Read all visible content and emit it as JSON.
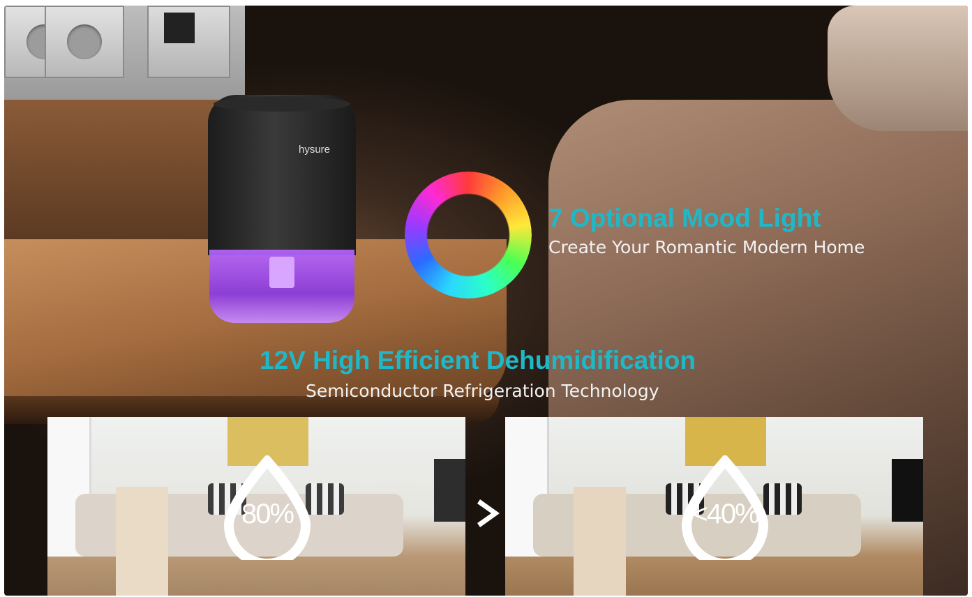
{
  "brand": "hysure",
  "feature1": {
    "title": "7 Optional Mood Light",
    "subtitle": "Create Your Romantic Modern Home"
  },
  "feature2": {
    "title": "12V High Efficient Dehumidification",
    "subtitle": "Semiconductor Refrigeration Technology"
  },
  "before": {
    "humidity": "80%"
  },
  "after": {
    "humidity": "<40%"
  },
  "colors": {
    "accent": "#1fb8c9",
    "tank_glow": "#b666ff"
  },
  "icons": [
    "water-drop-icon",
    "chevron-right-icon",
    "color-ring-icon"
  ]
}
